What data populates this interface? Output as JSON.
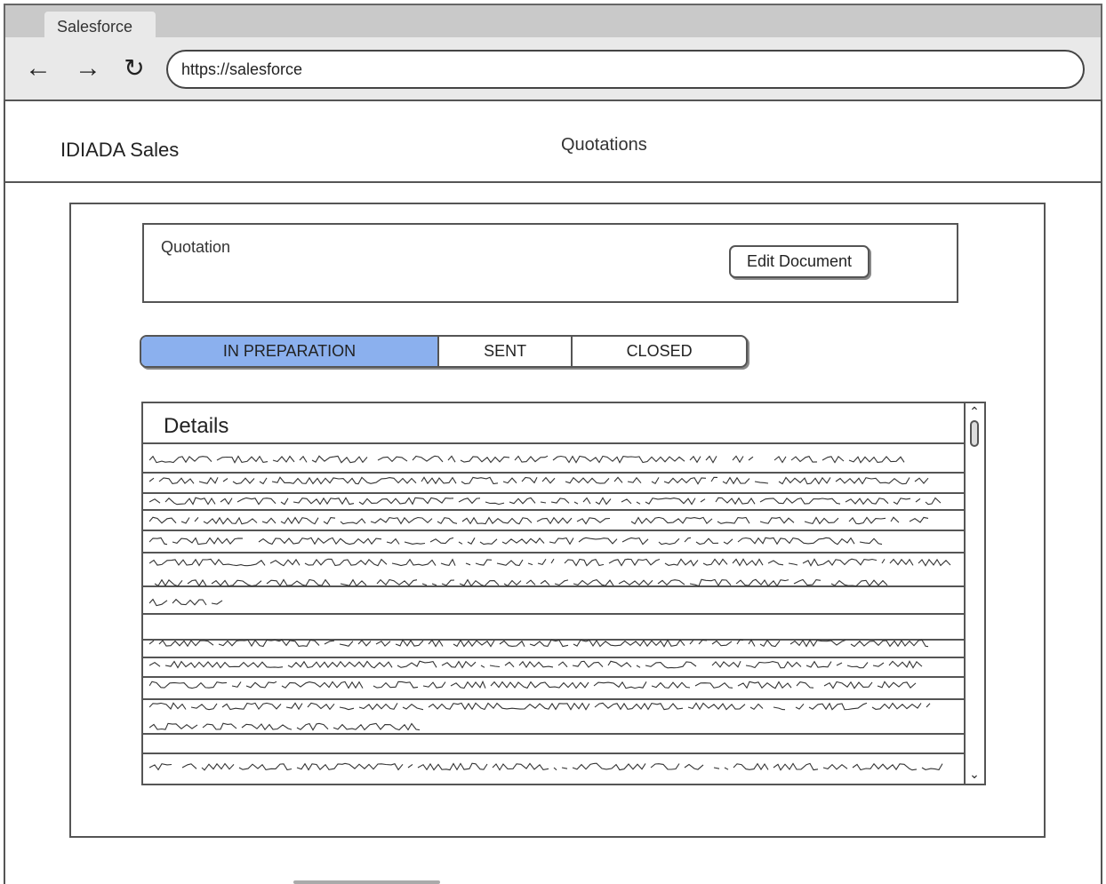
{
  "browser": {
    "tab_label": "Salesforce",
    "url": "https://salesforce",
    "nav_icons": [
      "arrow-left-icon",
      "arrow-right-icon",
      "reload-icon"
    ]
  },
  "header": {
    "brand": "IDIADA Sales",
    "page_title": "Quotations"
  },
  "quotation": {
    "label": "Quotation",
    "edit_button": "Edit Document"
  },
  "status": {
    "steps": [
      "IN PREPARATION",
      "SENT",
      "CLOSED"
    ],
    "active": "IN PREPARATION",
    "active_color": "#8bb0ee"
  },
  "details": {
    "title": "Details"
  }
}
